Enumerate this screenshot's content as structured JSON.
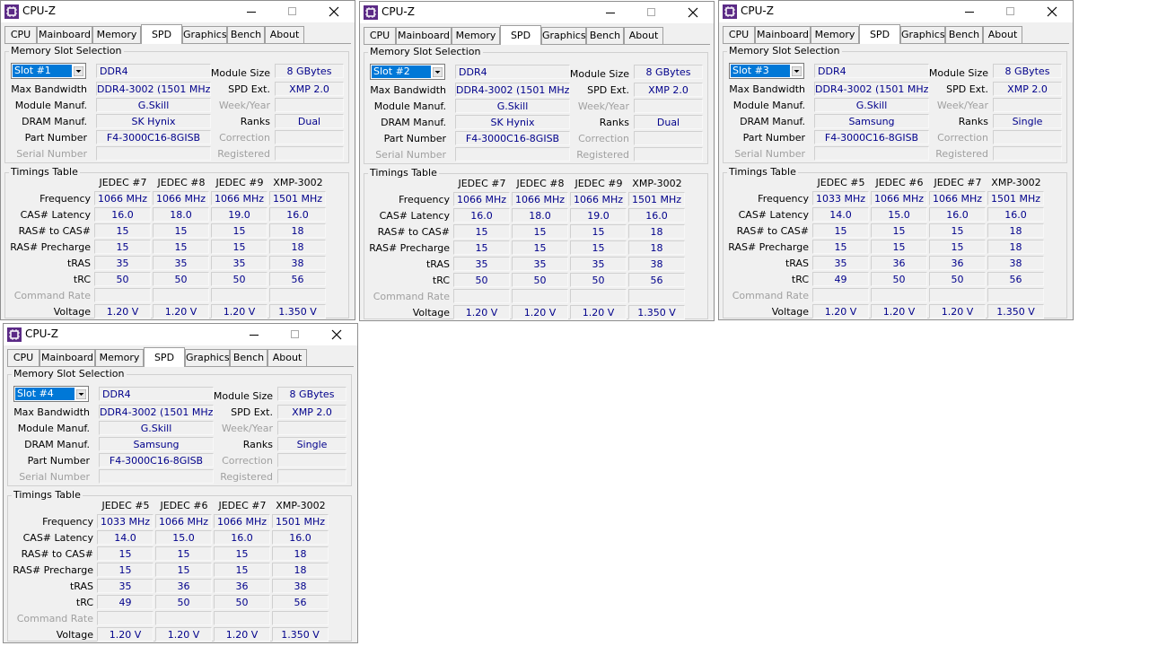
{
  "app": {
    "title": "CPU-Z"
  },
  "tabs": [
    "CPU",
    "Mainboard",
    "Memory",
    "SPD",
    "Graphics",
    "Bench",
    "About"
  ],
  "labels": {
    "memory_slot_selection": "Memory Slot Selection",
    "max_bandwidth": "Max Bandwidth",
    "module_manuf": "Module Manuf.",
    "dram_manuf": "DRAM Manuf.",
    "part_number": "Part Number",
    "serial_number": "Serial Number",
    "module_size": "Module Size",
    "spd_ext": "SPD Ext.",
    "week_year": "Week/Year",
    "ranks": "Ranks",
    "correction": "Correction",
    "registered": "Registered",
    "timings_table": "Timings Table",
    "rows": [
      "Frequency",
      "CAS# Latency",
      "RAS# to CAS#",
      "RAS# Precharge",
      "tRAS",
      "tRC",
      "Command Rate",
      "Voltage"
    ]
  },
  "windows": [
    {
      "slot": "Slot #1",
      "type": "DDR4",
      "max_bandwidth": "DDR4-3002 (1501 MHz)",
      "module_manuf": "G.Skill",
      "dram_manuf": "SK Hynix",
      "part_number": "F4-3000C16-8GISB",
      "module_size": "8 GBytes",
      "spd_ext": "XMP 2.0",
      "ranks": "Dual",
      "columns": [
        "JEDEC #7",
        "JEDEC #8",
        "JEDEC #9",
        "XMP-3002"
      ],
      "timings": [
        [
          "1066 MHz",
          "1066 MHz",
          "1066 MHz",
          "1501 MHz"
        ],
        [
          "16.0",
          "18.0",
          "19.0",
          "16.0"
        ],
        [
          "15",
          "15",
          "15",
          "18"
        ],
        [
          "15",
          "15",
          "15",
          "18"
        ],
        [
          "35",
          "35",
          "35",
          "38"
        ],
        [
          "50",
          "50",
          "50",
          "56"
        ],
        [
          "",
          "",
          "",
          ""
        ],
        [
          "1.20 V",
          "1.20 V",
          "1.20 V",
          "1.350 V"
        ]
      ]
    },
    {
      "slot": "Slot #2",
      "type": "DDR4",
      "max_bandwidth": "DDR4-3002 (1501 MHz)",
      "module_manuf": "G.Skill",
      "dram_manuf": "SK Hynix",
      "part_number": "F4-3000C16-8GISB",
      "module_size": "8 GBytes",
      "spd_ext": "XMP 2.0",
      "ranks": "Dual",
      "columns": [
        "JEDEC #7",
        "JEDEC #8",
        "JEDEC #9",
        "XMP-3002"
      ],
      "timings": [
        [
          "1066 MHz",
          "1066 MHz",
          "1066 MHz",
          "1501 MHz"
        ],
        [
          "16.0",
          "18.0",
          "19.0",
          "16.0"
        ],
        [
          "15",
          "15",
          "15",
          "18"
        ],
        [
          "15",
          "15",
          "15",
          "18"
        ],
        [
          "35",
          "35",
          "35",
          "38"
        ],
        [
          "50",
          "50",
          "50",
          "56"
        ],
        [
          "",
          "",
          "",
          ""
        ],
        [
          "1.20 V",
          "1.20 V",
          "1.20 V",
          "1.350 V"
        ]
      ]
    },
    {
      "slot": "Slot #3",
      "type": "DDR4",
      "max_bandwidth": "DDR4-3002 (1501 MHz)",
      "module_manuf": "G.Skill",
      "dram_manuf": "Samsung",
      "part_number": "F4-3000C16-8GISB",
      "module_size": "8 GBytes",
      "spd_ext": "XMP 2.0",
      "ranks": "Single",
      "columns": [
        "JEDEC #5",
        "JEDEC #6",
        "JEDEC #7",
        "XMP-3002"
      ],
      "timings": [
        [
          "1033 MHz",
          "1066 MHz",
          "1066 MHz",
          "1501 MHz"
        ],
        [
          "14.0",
          "15.0",
          "16.0",
          "16.0"
        ],
        [
          "15",
          "15",
          "15",
          "18"
        ],
        [
          "15",
          "15",
          "15",
          "18"
        ],
        [
          "35",
          "36",
          "36",
          "38"
        ],
        [
          "49",
          "50",
          "50",
          "56"
        ],
        [
          "",
          "",
          "",
          ""
        ],
        [
          "1.20 V",
          "1.20 V",
          "1.20 V",
          "1.350 V"
        ]
      ]
    },
    {
      "slot": "Slot #4",
      "type": "DDR4",
      "max_bandwidth": "DDR4-3002 (1501 MHz)",
      "module_manuf": "G.Skill",
      "dram_manuf": "Samsung",
      "part_number": "F4-3000C16-8GISB",
      "module_size": "8 GBytes",
      "spd_ext": "XMP 2.0",
      "ranks": "Single",
      "columns": [
        "JEDEC #5",
        "JEDEC #6",
        "JEDEC #7",
        "XMP-3002"
      ],
      "timings": [
        [
          "1033 MHz",
          "1066 MHz",
          "1066 MHz",
          "1501 MHz"
        ],
        [
          "14.0",
          "15.0",
          "16.0",
          "16.0"
        ],
        [
          "15",
          "15",
          "15",
          "18"
        ],
        [
          "15",
          "15",
          "15",
          "18"
        ],
        [
          "35",
          "36",
          "36",
          "38"
        ],
        [
          "49",
          "50",
          "50",
          "56"
        ],
        [
          "",
          "",
          "",
          ""
        ],
        [
          "1.20 V",
          "1.20 V",
          "1.20 V",
          "1.350 V"
        ]
      ]
    }
  ],
  "colors": {
    "value_text": "#00008b",
    "selection": "#0078d7",
    "icon": "#5b2a86"
  }
}
